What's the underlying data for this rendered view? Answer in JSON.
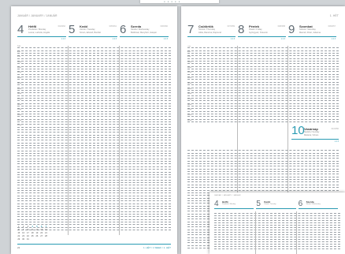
{
  "left_page": {
    "header": "JANUÁR / JANUARY / JANUÁR",
    "days": [
      {
        "num": "4",
        "name": "Hétfő",
        "sub1": "Pondelok / Monday",
        "sub2": "Leona, Ludmila, Angéla",
        "wk": "004/362",
        "mini": "1 2 3"
      },
      {
        "num": "5",
        "name": "Kedd",
        "sub1": "Utorok / Tuesday",
        "sub2": "Simon, Edvard, Bonifác",
        "wk": "005/361",
        "mini": "1 2 3"
      },
      {
        "num": "6",
        "name": "Szerda",
        "sub1": "Streda / Wednesday",
        "sub2": "Boldizsár, Menyhért, Gáspár",
        "wk": "006/360",
        "mini": "1 2 3"
      }
    ],
    "footer_left": "22",
    "footer_right": "1. HÉT / 1 WEEK / 1. HÉT",
    "mini_calendar": [
      [
        "1",
        "2",
        "3",
        "4",
        "5",
        "6",
        "7"
      ],
      [
        "8",
        "9",
        "10",
        "11",
        "12",
        "13",
        "14"
      ],
      [
        "15",
        "16",
        "17",
        "18",
        "19",
        "20",
        "21"
      ],
      [
        "22",
        "23",
        "24",
        "25",
        "26",
        "27",
        "28"
      ],
      [
        "29",
        "30",
        "31",
        "",
        "",
        "",
        ""
      ]
    ]
  },
  "right_page": {
    "header": "1. HÉT",
    "days": [
      {
        "num": "7",
        "name": "Csütörtök",
        "sub1": "Štvrtok / Thursday",
        "sub2": "Attila, Ramóna, Rajmund",
        "wk": "007/359",
        "mini": "1 2 3"
      },
      {
        "num": "8",
        "name": "Péntek",
        "sub1": "Piatok / Friday",
        "sub2": "Gyöngyvér, Szeverin",
        "wk": "008/358",
        "mini": "1 2 3"
      },
      {
        "num": "9",
        "name": "Szombat",
        "sub1": "Sobota / Saturday",
        "sub2": "Marcell, Péter, Julianna",
        "wk": "009/357",
        "mini": "1 2 3"
      }
    ],
    "sunday": {
      "num": "10",
      "name": "Vasárnap",
      "sub1": "Nedeľa / Sunday",
      "sub2": "Melánia, Vilmos",
      "wk": "010/356",
      "mini": "1 2 3"
    }
  },
  "thumb_page": {
    "header": "JANUÁR / JANUARY / JANUÁR",
    "days": [
      {
        "num": "4",
        "name": "Hétfő",
        "sub1": "Pondelok / Monday"
      },
      {
        "num": "5",
        "name": "Kedd",
        "sub1": "Utorok / Tuesday"
      },
      {
        "num": "6",
        "name": "Szerda",
        "sub1": "Streda / Wednesday"
      }
    ]
  },
  "time_labels": [
    "7.00",
    "",
    "8.00",
    "",
    "9.00",
    "",
    "10.00",
    "",
    "11.00",
    "",
    "12.00",
    "",
    "13.00",
    "",
    "14.00",
    "",
    "15.00",
    "",
    "16.00",
    "",
    "17.00",
    "",
    "18.00",
    "",
    "19.00",
    "",
    "20.00",
    "",
    "21.00",
    "",
    "22.00"
  ],
  "colors": {
    "accent": "#2a9bb3",
    "text": "#333333"
  }
}
